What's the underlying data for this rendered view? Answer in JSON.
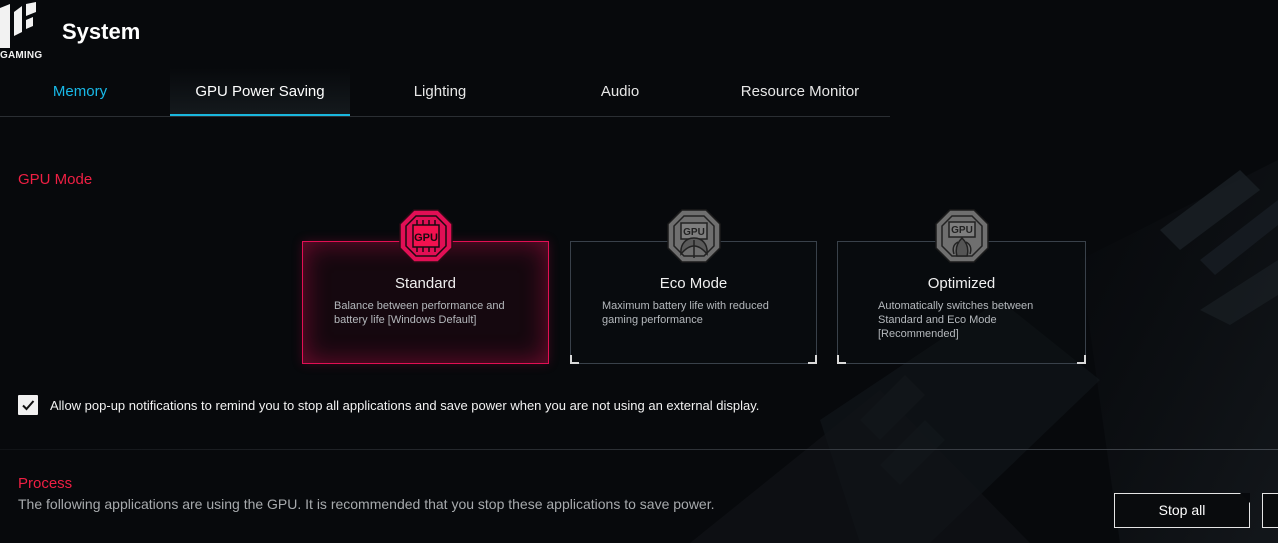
{
  "app": {
    "logo_text": "GAMING",
    "title": "System"
  },
  "tabs": [
    {
      "label": "Memory"
    },
    {
      "label": "GPU Power Saving"
    },
    {
      "label": "Lighting"
    },
    {
      "label": "Audio"
    },
    {
      "label": "Resource Monitor"
    }
  ],
  "gpu_mode": {
    "title": "GPU Mode",
    "modes": [
      {
        "name": "Standard",
        "description": "Balance between performance and battery life [Windows Default]",
        "icon": "gpu-chip-icon",
        "selected": true
      },
      {
        "name": "Eco Mode",
        "description": "Maximum battery life with reduced gaming performance",
        "icon": "gpu-eco-leaf-icon",
        "selected": false
      },
      {
        "name": "Optimized",
        "description": "Automatically switches between Standard and Eco Mode [Recommended]",
        "icon": "gpu-optimized-icon",
        "selected": false
      }
    ]
  },
  "notification": {
    "checked": true,
    "label": "Allow pop-up notifications to remind you to stop all applications and save power when you are not using an external display."
  },
  "process": {
    "title": "Process",
    "description": "The following applications are using the GPU. It is recommended that you stop these applications to save power.",
    "stop_all_label": "Stop all"
  },
  "colors": {
    "accent_red": "#ef1f43",
    "accent_cyan": "#18b9e8",
    "selected_border": "#e20f54",
    "background": "#07090c"
  }
}
